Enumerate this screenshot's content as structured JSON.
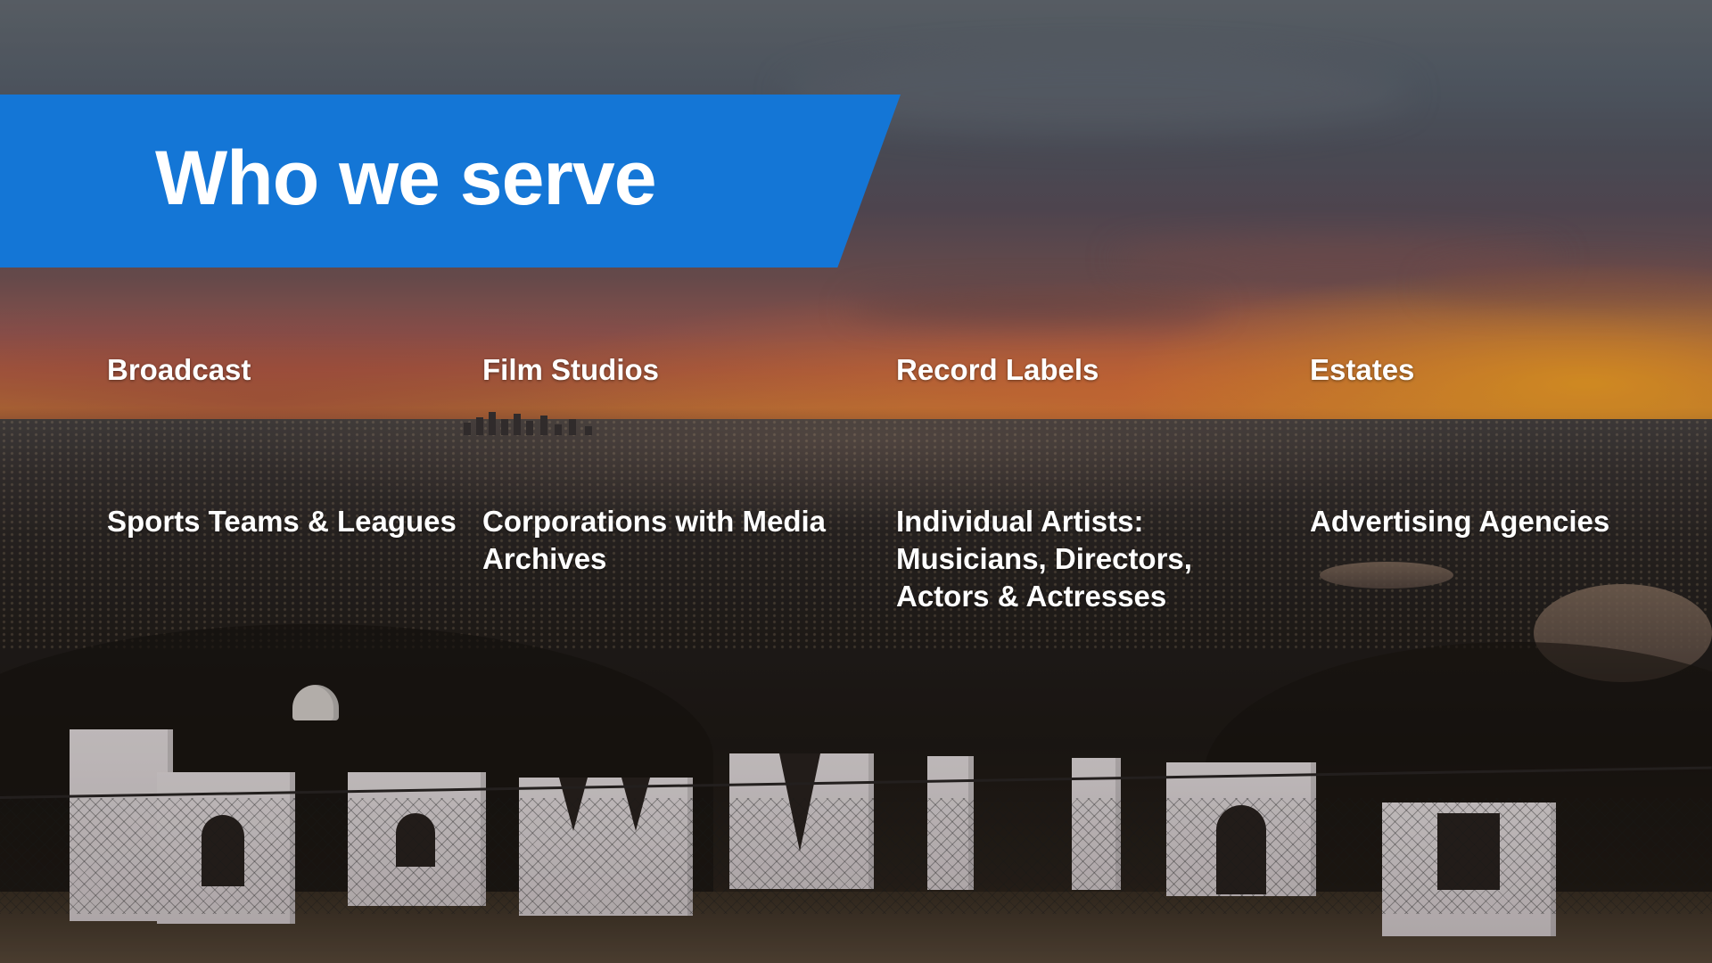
{
  "slide": {
    "title": "Who we serve",
    "accent_color": "#1476D6"
  },
  "categories": [
    {
      "label": "Broadcast"
    },
    {
      "label": "Film Studios"
    },
    {
      "label": "Record Labels"
    },
    {
      "label": "Estates"
    },
    {
      "label": "Sports Teams & Leagues"
    },
    {
      "label": "Corporations with Media Archives"
    },
    {
      "label": "Individual Artists: Musicians, Directors, Actors & Actresses"
    },
    {
      "label": "Advertising Agencies"
    }
  ]
}
